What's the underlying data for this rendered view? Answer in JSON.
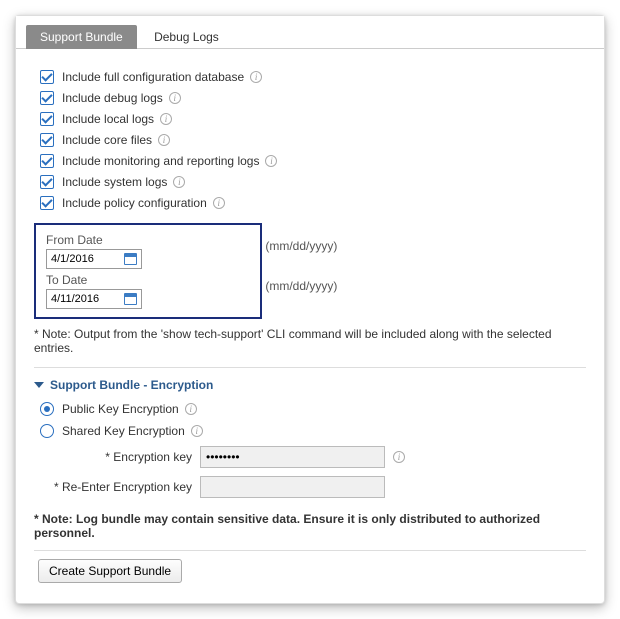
{
  "tabs": {
    "active": "Support Bundle",
    "inactive": "Debug Logs"
  },
  "checks": [
    {
      "label": "Include full configuration database",
      "checked": true
    },
    {
      "label": "Include debug logs",
      "checked": true
    },
    {
      "label": "Include local logs",
      "checked": true
    },
    {
      "label": "Include core files",
      "checked": true
    },
    {
      "label": "Include monitoring and reporting logs",
      "checked": true
    },
    {
      "label": "Include system logs",
      "checked": true
    },
    {
      "label": "Include policy configuration",
      "checked": true
    }
  ],
  "dates": {
    "from_label": "From Date",
    "from_value": "4/1/2016",
    "to_label": "To Date",
    "to_value": "4/11/2016",
    "format_hint": "(mm/dd/yyyy)"
  },
  "note1": "* Note: Output from the 'show tech-support' CLI command will be included along with the selected entries.",
  "section_title": "Support Bundle - Encryption",
  "radios": {
    "public": "Public Key Encryption",
    "shared": "Shared Key Encryption",
    "selected": "public"
  },
  "fields": {
    "key_label": "* Encryption key",
    "key_value": "••••••••",
    "rekey_label": "* Re-Enter Encryption key",
    "rekey_value": ""
  },
  "note2": "* Note: Log bundle may contain sensitive data. Ensure it is only distributed to authorized personnel.",
  "create_button": "Create Support Bundle"
}
